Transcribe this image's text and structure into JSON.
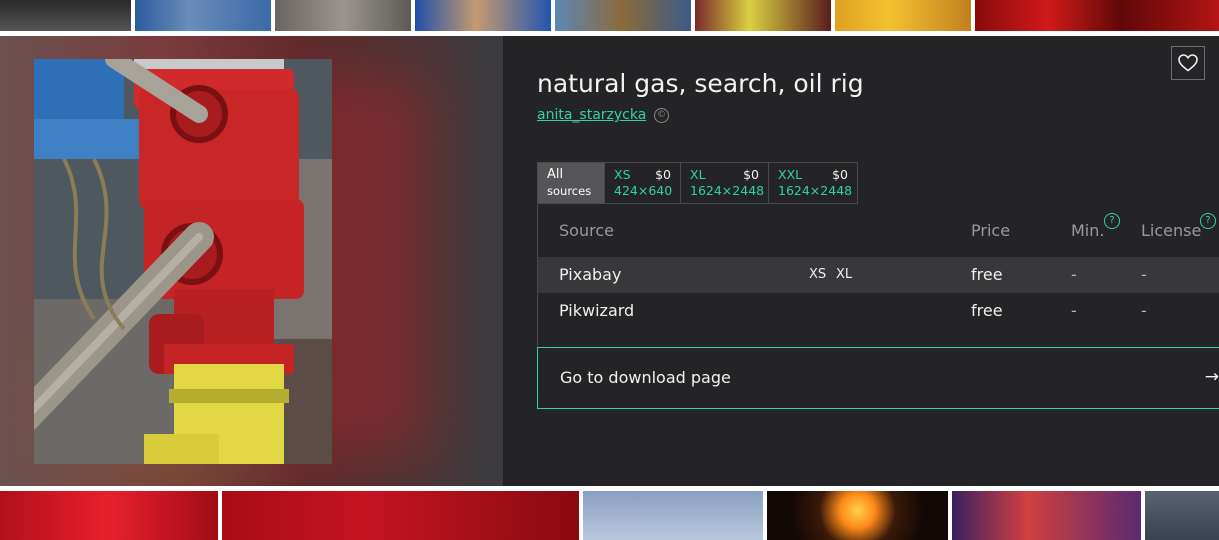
{
  "preview": {
    "title": "natural gas, search, oil rig",
    "author": "anita_starzycka",
    "copyright_symbol": "©"
  },
  "size_tabs": [
    {
      "line1": "All",
      "line2": "sources",
      "active": true
    },
    {
      "label": "XS",
      "price": "$0",
      "dims": "424×640"
    },
    {
      "label": "XL",
      "price": "$0",
      "dims": "1624×2448"
    },
    {
      "label": "XXL",
      "price": "$0",
      "dims": "1624×2448"
    }
  ],
  "table": {
    "headers": {
      "source": "Source",
      "price": "Price",
      "min": "Min.",
      "license": "License"
    },
    "help_symbol": "?",
    "rows": [
      {
        "source": "Pixabay",
        "sizes": [
          "XS",
          "XL"
        ],
        "price": "free",
        "min": "-",
        "license": "-"
      },
      {
        "source": "Pikwizard",
        "sizes": [],
        "price": "free",
        "min": "-",
        "license": "-"
      }
    ]
  },
  "download": {
    "label": "Go to download page",
    "arrow": "→"
  },
  "icons": {
    "favorite": "heart-icon",
    "copyright": "copyright-icon",
    "help": "help-icon",
    "arrow": "arrow-right-icon"
  },
  "colors": {
    "accent": "#2fd3a5",
    "panel": "#242426",
    "active_tab": "#555558",
    "row_highlight": "#38383b"
  }
}
